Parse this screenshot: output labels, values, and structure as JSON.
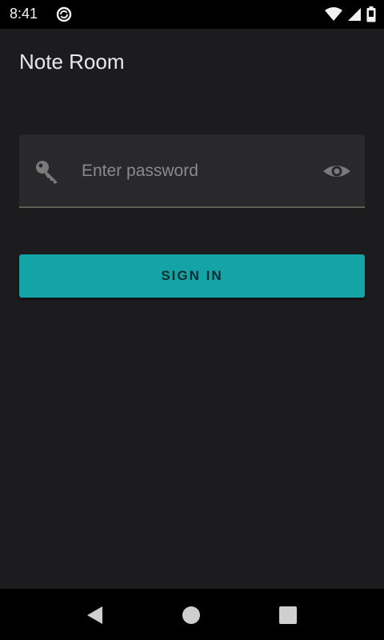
{
  "status_bar": {
    "time": "8:41"
  },
  "app_bar": {
    "title": "Note Room"
  },
  "password_field": {
    "placeholder": "Enter password",
    "value": "",
    "leading_icon": "key-icon",
    "trailing_icon": "eye-icon"
  },
  "sign_in_button": {
    "label": "SIGN IN"
  },
  "nav_bar": {
    "back_icon": "back-icon",
    "home_icon": "home-icon",
    "recents_icon": "recents-icon"
  },
  "colors": {
    "background": "#1c1c1f",
    "accent": "#14a3a6",
    "field_background": "#29292c"
  }
}
